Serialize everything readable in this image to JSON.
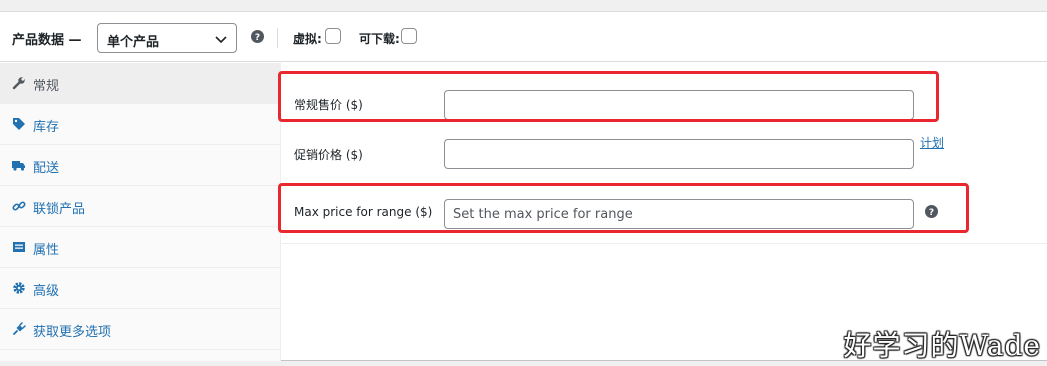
{
  "header": {
    "title": "产品数据 —",
    "product_type": "单个产品",
    "virtual_label": "虚拟:",
    "downloadable_label": "可下载:"
  },
  "sidebar": {
    "items": [
      {
        "label": "常规",
        "icon": "wrench-icon"
      },
      {
        "label": "库存",
        "icon": "tag-icon"
      },
      {
        "label": "配送",
        "icon": "truck-icon"
      },
      {
        "label": "联锁产品",
        "icon": "link-icon"
      },
      {
        "label": "属性",
        "icon": "list-icon"
      },
      {
        "label": "高级",
        "icon": "gear-icon"
      },
      {
        "label": "获取更多选项",
        "icon": "plugin-icon"
      }
    ]
  },
  "fields": {
    "regular_price_label": "常规售价 ($)",
    "regular_price_value": "",
    "sale_price_label": "促销价格 ($)",
    "sale_price_value": "",
    "schedule_link": "计划",
    "max_price_label": "Max price for range ($)",
    "max_price_placeholder": "Set the max price for range"
  },
  "watermark": "好学习的Wade",
  "colors": {
    "highlight": "#e8272f",
    "link": "#2271b1"
  }
}
